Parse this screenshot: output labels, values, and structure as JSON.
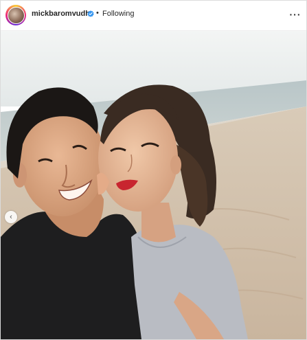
{
  "post": {
    "username": "mickbaromvudh",
    "verified_icon": "verified-badge-icon",
    "separator": "•",
    "follow_status": "Following",
    "more_icon": "more-options-icon",
    "more_glyph": "···"
  },
  "photo": {
    "alt": "Selfie of a smiling couple on a sandy beach at dusk",
    "carousel_prev_glyph": "‹"
  },
  "colors": {
    "verified": "#3897f0",
    "text": "#262626",
    "border": "#dbdbdb"
  }
}
